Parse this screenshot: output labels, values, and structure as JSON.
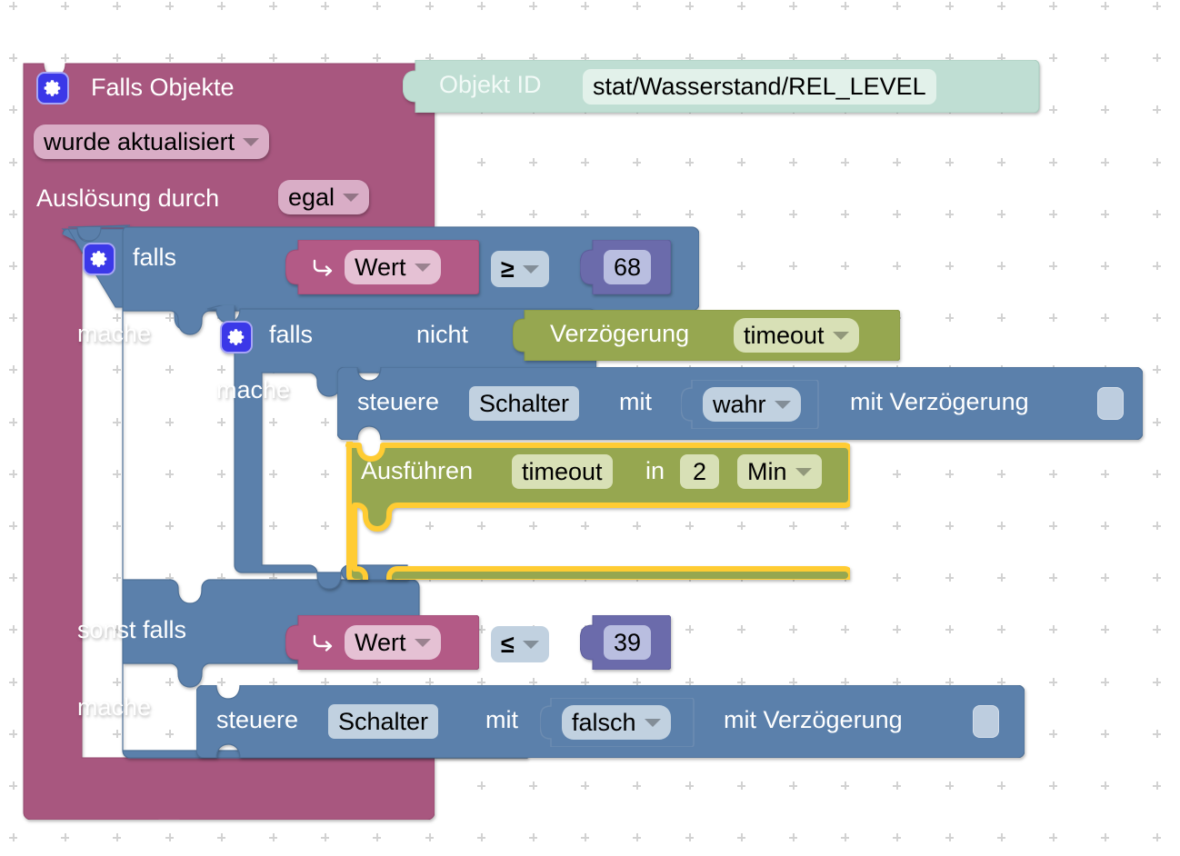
{
  "app": {
    "type": "blockly-visual-script-editor",
    "language": "de",
    "background": "#ffffff",
    "grid_dot_color": "#d2d2d2"
  },
  "colors": {
    "trigger_magenta": "#a8577f",
    "trigger_magenta_field": "#d9adc6",
    "object_mint": "#bfded3",
    "object_mint_field": "#e2f1ea",
    "control_blue": "#5b80ab",
    "control_blue_field": "#c1d1e0",
    "timeouts_olive": "#96a750",
    "timeouts_olive_field": "#d8e0b6",
    "value_pink": "#b35a86",
    "value_pink_field": "#e5c1d4",
    "math_purple": "#6b6bab",
    "math_purple_field": "#b9bee0",
    "compare_lightblue": "#c1d1e0",
    "highlight_yellow": "#ffcc33",
    "gear_icon_blue": "#3b38e8"
  },
  "trigger_block": {
    "name": "on-object-change-trigger",
    "title": "Falls Objekte",
    "gear_icon": "gear-icon",
    "event_dropdown": {
      "value": "wurde aktualisiert",
      "caret": "chevron-down-icon"
    },
    "source_label": "Auslösung durch",
    "source_dropdown": {
      "value": "egal",
      "caret": "chevron-down-icon"
    }
  },
  "object_id_block": {
    "name": "object-id-block",
    "label": "Objekt ID",
    "value": "stat/Wasserstand/REL_LEVEL"
  },
  "outer_if": {
    "name": "if-else-if-block",
    "gear_icon": "gear-icon",
    "if_label": "falls",
    "do_label": "mache",
    "else_if_label": "sonst falls",
    "else_do_label": "mache",
    "condition_1": {
      "name": "comparison-greater-equal",
      "left": {
        "icon": "return-arrow-icon",
        "dropdown_value": "Wert",
        "caret": "chevron-down-icon"
      },
      "operator": "≥",
      "operator_caret": "chevron-down-icon",
      "right_number": "68"
    },
    "condition_2": {
      "name": "comparison-less-equal",
      "left": {
        "icon": "return-arrow-icon",
        "dropdown_value": "Wert",
        "caret": "chevron-down-icon"
      },
      "operator": "≤",
      "operator_caret": "chevron-down-icon",
      "right_number": "39"
    }
  },
  "inner_if": {
    "name": "inner-if-block",
    "gear_icon": "gear-icon",
    "if_label": "falls",
    "do_label": "mache",
    "not_label": "nicht",
    "delay_check": {
      "name": "timeout-running-block",
      "label": "Verzögerung",
      "dropdown_value": "timeout",
      "caret": "chevron-down-icon"
    }
  },
  "control_true": {
    "name": "control-state-block-true",
    "prefix": "steuere",
    "target": "Schalter",
    "with_label": "mit",
    "value_dropdown": "wahr",
    "value_caret": "chevron-down-icon",
    "delay_label": "mit Verzögerung",
    "delay_socket": "empty-value-socket"
  },
  "control_false": {
    "name": "control-state-block-false",
    "prefix": "steuere",
    "target": "Schalter",
    "with_label": "mit",
    "value_dropdown": "falsch",
    "value_caret": "chevron-down-icon",
    "delay_label": "mit Verzögerung",
    "delay_socket": "empty-value-socket"
  },
  "timeout_block": {
    "name": "schedule-timeout-block",
    "selected": true,
    "prefix": "Ausführen",
    "timeout_name": "timeout",
    "in_label": "in",
    "amount": "2",
    "unit_dropdown": "Min",
    "unit_caret": "chevron-down-icon"
  }
}
